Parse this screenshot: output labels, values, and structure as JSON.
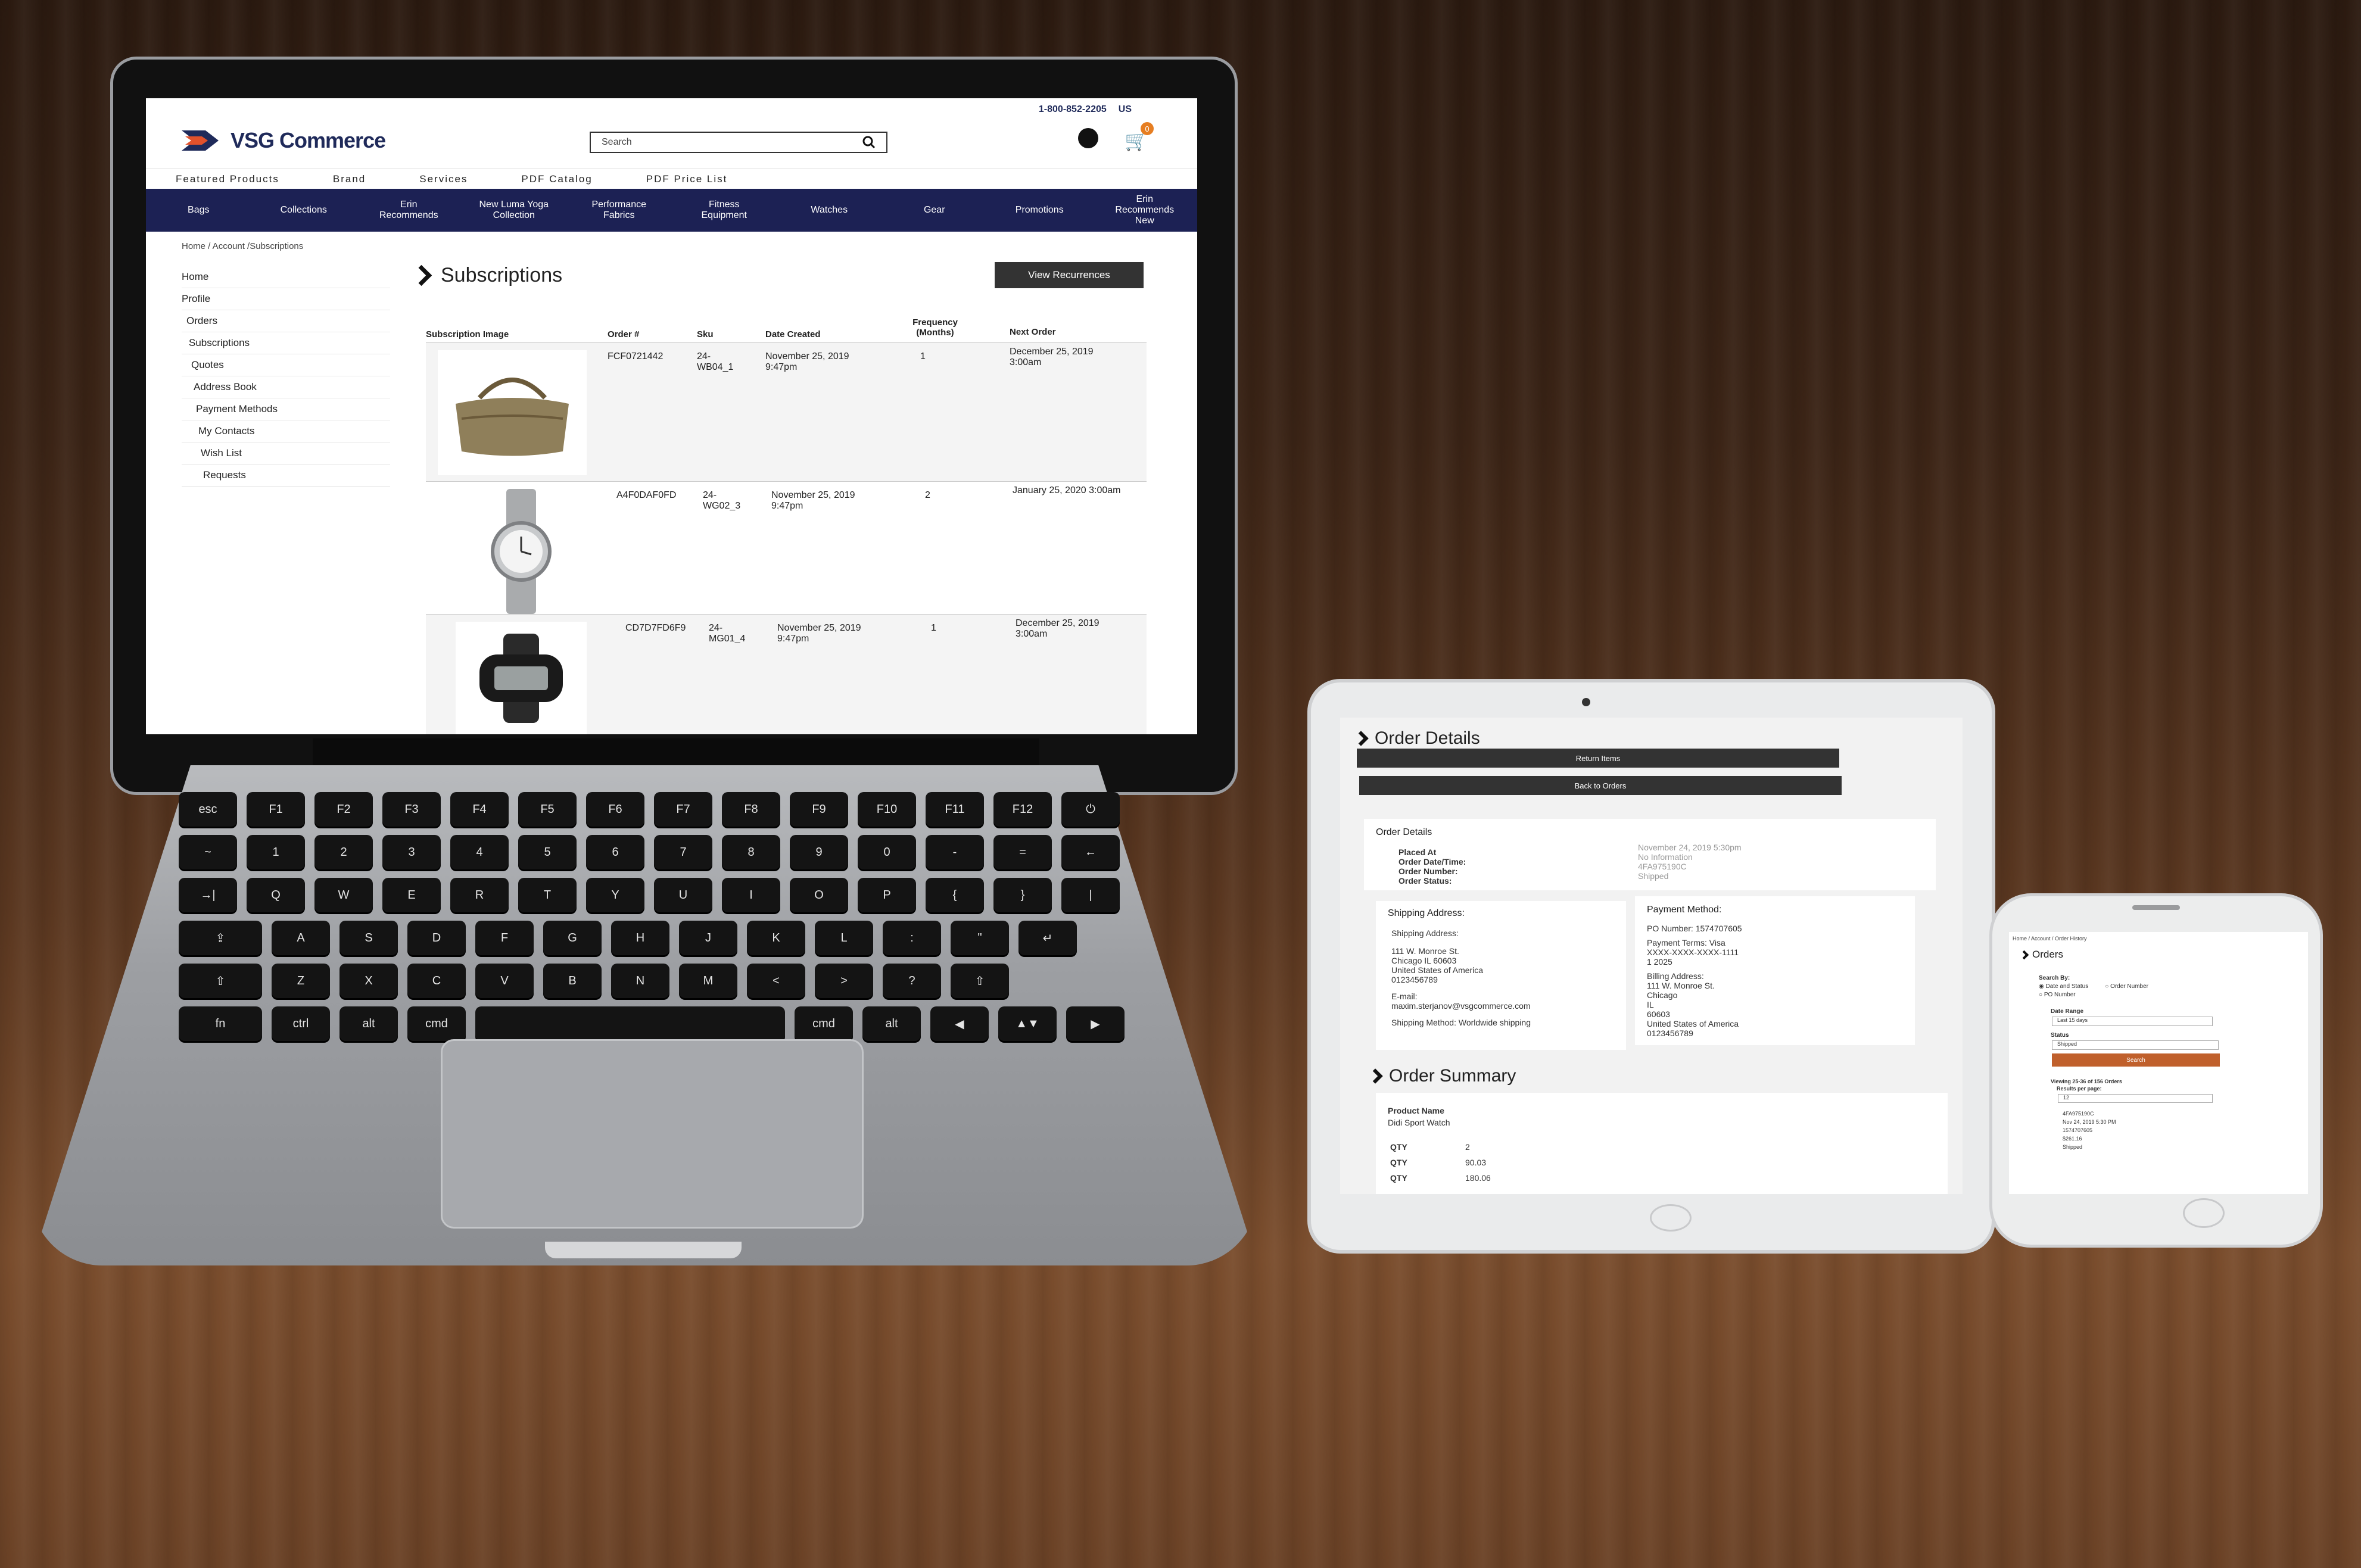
{
  "laptop": {
    "phone": "1-800-852-2205",
    "region": "US",
    "brand": "VSG Commerce",
    "search_placeholder": "Search",
    "cart_count": "0",
    "subnav": [
      "Featured Products",
      "Brand",
      "Services",
      "PDF Catalog",
      "PDF Price List"
    ],
    "mainnav": [
      "Bags",
      "Collections",
      "Erin Recommends",
      "New Luma Yoga Collection",
      "Performance Fabrics",
      "Fitness Equipment",
      "Watches",
      "Gear",
      "Promotions",
      "Erin Recommends New"
    ],
    "breadcrumb": "Home / Account /Subscriptions",
    "sidebar": [
      "Home",
      "Profile",
      "Orders",
      "Subscriptions",
      "Quotes",
      "Address Book",
      "Payment Methods",
      "My Contacts",
      "Wish List",
      "Requests"
    ],
    "title": "Subscriptions",
    "view_button": "View Recurrences",
    "table": {
      "headers": [
        "Subscription Image",
        "Order #",
        "Sku",
        "Date Created",
        "Frequency (Months)",
        "Next Order"
      ],
      "rows": [
        {
          "order": "FCF0721442",
          "sku": "24-WB04_1",
          "created": "November 25, 2019 9:47pm",
          "freq": "1",
          "next": "December 25, 2019 3:00am",
          "image": "bag"
        },
        {
          "order": "A4F0DAF0FD",
          "sku": "24-WG02_3",
          "created": "November 25, 2019 9:47pm",
          "freq": "2",
          "next": "January 25, 2020 3:00am",
          "image": "metal-watch"
        },
        {
          "order": "CD7D7FD6F9",
          "sku": "24-MG01_4",
          "created": "November 25, 2019 9:47pm",
          "freq": "1",
          "next": "December 25, 2019 3:00am",
          "image": "digital-watch"
        }
      ]
    }
  },
  "tablet": {
    "title": "Order Details",
    "return_button": "Return Items",
    "back_button": "Back to Orders",
    "details_heading": "Order Details",
    "detail_labels": [
      "Placed At",
      "Order Date/Time:",
      "Order Number:",
      "Order Status:"
    ],
    "detail_values": [
      "November 24, 2019 5:30pm",
      "No Information",
      "4FA975190C",
      "Shipped"
    ],
    "shipping_heading": "Shipping Address:",
    "shipping_lines": [
      "Shipping Address:",
      "111 W. Monroe St.",
      "Chicago IL 60603",
      "United States of America",
      "0123456789",
      "E-mail:",
      "maxim.sterjanov@vsgcommerce.com",
      "Shipping Method: Worldwide shipping"
    ],
    "payment_heading": "Payment Method:",
    "payment_lines": [
      "PO Number: 1574707605",
      "Payment Terms: Visa",
      "XXXX-XXXX-XXXX-1111",
      "1 2025",
      "Billing Address:",
      "111 W. Monroe St.",
      "Chicago",
      "IL",
      "60603",
      "United States of America",
      "0123456789"
    ],
    "summary_title": "Order Summary",
    "product_label": "Product Name",
    "product_value": "Didi Sport Watch",
    "summary_labels": [
      "QTY",
      "QTY",
      "QTY"
    ],
    "summary_values": [
      "2",
      "90.03",
      "180.06"
    ]
  },
  "phone": {
    "breadcrumb": "Home / Account / Order History",
    "title": "Orders",
    "search_by": "Search By:",
    "radio_options": [
      "Date and Status",
      "Order Number",
      "PO Number"
    ],
    "date_range_label": "Date Range",
    "date_range_value": "Last 15 days",
    "status_label": "Status",
    "status_value": "Shipped",
    "search_button": "Search",
    "viewing": "Viewing 25-36 of 156 Orders",
    "results_label": "Results per page:",
    "results_value": "12",
    "order_lines": [
      "4FA975190C",
      "Nov 24, 2019 5:30 PM",
      "1574707605",
      "$261.16",
      "Shipped"
    ]
  },
  "colors": {
    "navy": "#1c2154",
    "button_dark": "#333333",
    "phone_search": "#c0602c",
    "cart_badge": "#e67e22"
  }
}
